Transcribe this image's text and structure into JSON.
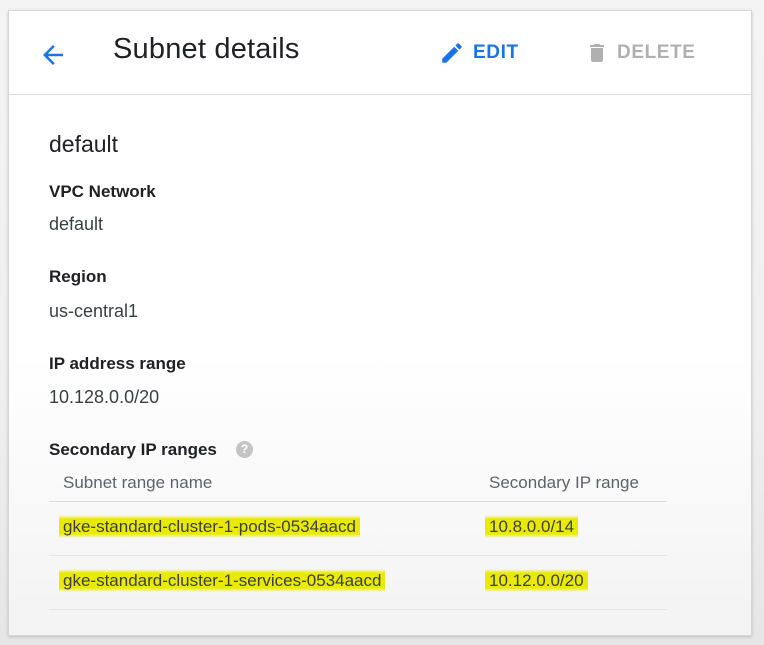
{
  "header": {
    "title": "Subnet details",
    "edit_label": "EDIT",
    "delete_label": "DELETE"
  },
  "subnet": {
    "name": "default",
    "vpc_network_label": "VPC Network",
    "vpc_network_value": "default",
    "region_label": "Region",
    "region_value": "us-central1",
    "ip_range_label": "IP address range",
    "ip_range_value": "10.128.0.0/20",
    "secondary_label": "Secondary IP ranges"
  },
  "secondary_table": {
    "columns": [
      "Subnet range name",
      "Secondary IP range"
    ],
    "rows": [
      {
        "name": "gke-standard-cluster-1-pods-0534aacd",
        "range": "10.8.0.0/14",
        "highlighted": true
      },
      {
        "name": "gke-standard-cluster-1-services-0534aacd",
        "range": "10.12.0.0/20",
        "highlighted": true
      }
    ]
  },
  "icons": {
    "back": "arrow-back-icon",
    "edit": "pencil-icon",
    "delete": "trash-icon",
    "help": "help-icon"
  },
  "colors": {
    "accent": "#1a73e8",
    "disabled": "#b0b0b0",
    "highlight": "#eaeb00"
  }
}
